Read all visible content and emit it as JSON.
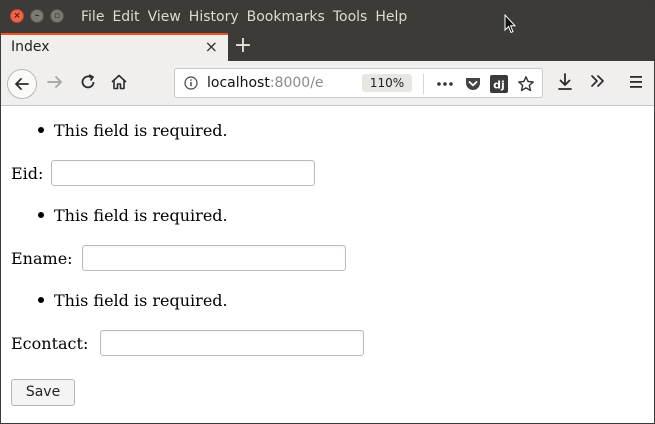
{
  "window": {
    "menu": [
      "File",
      "Edit",
      "View",
      "History",
      "Bookmarks",
      "Tools",
      "Help"
    ]
  },
  "tab": {
    "title": "Index",
    "close": "×"
  },
  "toolbar": {
    "url_host": "localhost",
    "url_rest": ":8000/e",
    "zoom": "110%"
  },
  "form": {
    "fields": [
      {
        "error": "This field is required.",
        "label": "Eid:"
      },
      {
        "error": "This field is required.",
        "label": "Ename:"
      },
      {
        "error": "This field is required.",
        "label": "Econtact:"
      }
    ],
    "submit_label": "Save"
  }
}
